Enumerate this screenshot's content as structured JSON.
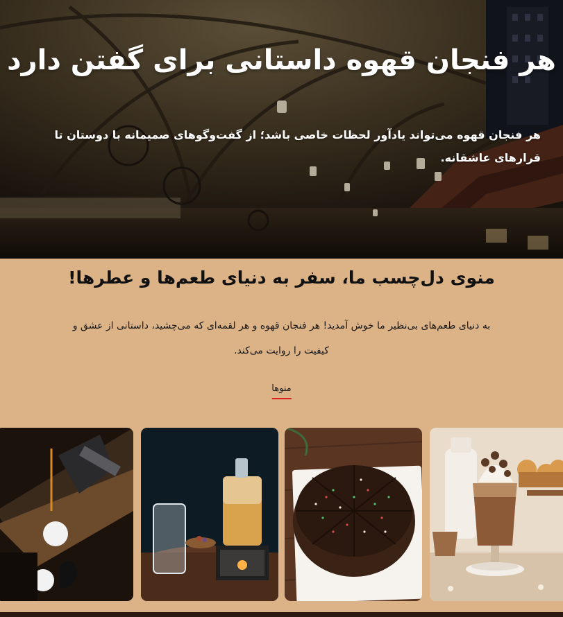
{
  "hero": {
    "title": "هر فنجان قهوه داستانی برای گفتن دارد",
    "text": "هر فنجان قهوه می‌تواند یادآور لحظات خاصی باشد؛ از گفت‌وگوهای صمیمانه با دوستان تا قرارهای عاشقانه."
  },
  "menu": {
    "title": "منوی دل‌چسب ما، سفر به دنیای طعم‌ها و عطرها!",
    "intro": "به دنیای طعم‌های بی‌نظیر ما خوش آمدید! هر فنجان قهوه و هر لقمه‌ای که می‌چشید، داستانی از عشق و کیفیت را روایت می‌کند.",
    "link_label": "منوها"
  },
  "colors": {
    "background": "#dcb287",
    "accent": "#e02020",
    "text_dark": "#111111"
  },
  "cards": [
    {
      "subject": "iced-coffee-drink"
    },
    {
      "subject": "chocolate-cake"
    },
    {
      "subject": "tea-pots"
    },
    {
      "subject": "espresso-machine"
    }
  ]
}
